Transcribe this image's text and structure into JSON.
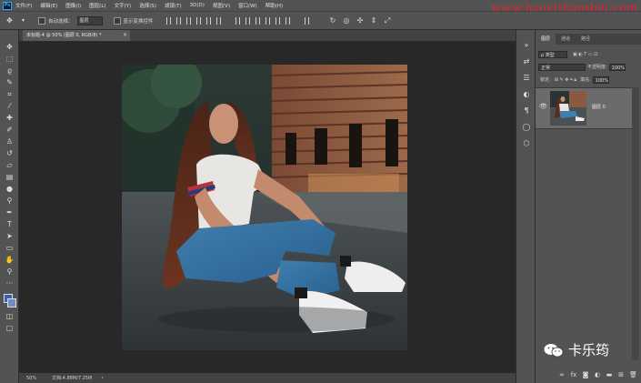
{
  "app": {
    "logo": "Ps"
  },
  "menubar": {
    "items": [
      "文件(F)",
      "编辑(E)",
      "图像(I)",
      "图层(L)",
      "文字(Y)",
      "选择(S)",
      "滤镜(T)",
      "3D(D)",
      "视图(V)",
      "窗口(W)",
      "帮助(H)"
    ]
  },
  "watermark": "www.haoyishanshei.com",
  "options": {
    "auto_select_label": "自动选择：",
    "auto_select_value": "图层",
    "transform_label": "显示变换控件"
  },
  "document": {
    "tab_title": "未标题-4 @ 50% (图层 0, RGB/8) *",
    "close_glyph": "×"
  },
  "status": {
    "zoom": "50%",
    "doc_info": "文档:4.88M/7.25M",
    "arrow": "›"
  },
  "layers_panel": {
    "tabs": [
      "图层",
      "通道",
      "路径"
    ],
    "kind_filter": "ρ 类型",
    "blend_mode": "正常",
    "opacity_label": "不透明度:",
    "opacity_value": "100%",
    "lock_label": "锁定:",
    "fill_label": "填充:",
    "fill_value": "100%",
    "layer_name": "图层 0"
  },
  "wechat_label": "卡乐筠",
  "colors": {
    "ui_dark": "#535353",
    "canvas_bg": "#282828",
    "fg_color": "#3d5fa8",
    "bg_color": "#6e8cc7",
    "watermark": "#e8232a"
  },
  "icons": {
    "tools": [
      "move-icon",
      "marquee-icon",
      "lasso-icon",
      "quick-select-icon",
      "crop-icon",
      "eyedropper-icon",
      "healing-icon",
      "brush-icon",
      "stamp-icon",
      "history-brush-icon",
      "eraser-icon",
      "gradient-icon",
      "blur-icon",
      "dodge-icon",
      "pen-icon",
      "type-icon",
      "path-select-icon",
      "shape-icon",
      "hand-icon",
      "zoom-icon",
      "more-icon"
    ],
    "strip": [
      "history-icon",
      "properties-icon",
      "adjust-icon",
      "brush-settings-icon",
      "swatch-icon",
      "3d-icon"
    ]
  }
}
